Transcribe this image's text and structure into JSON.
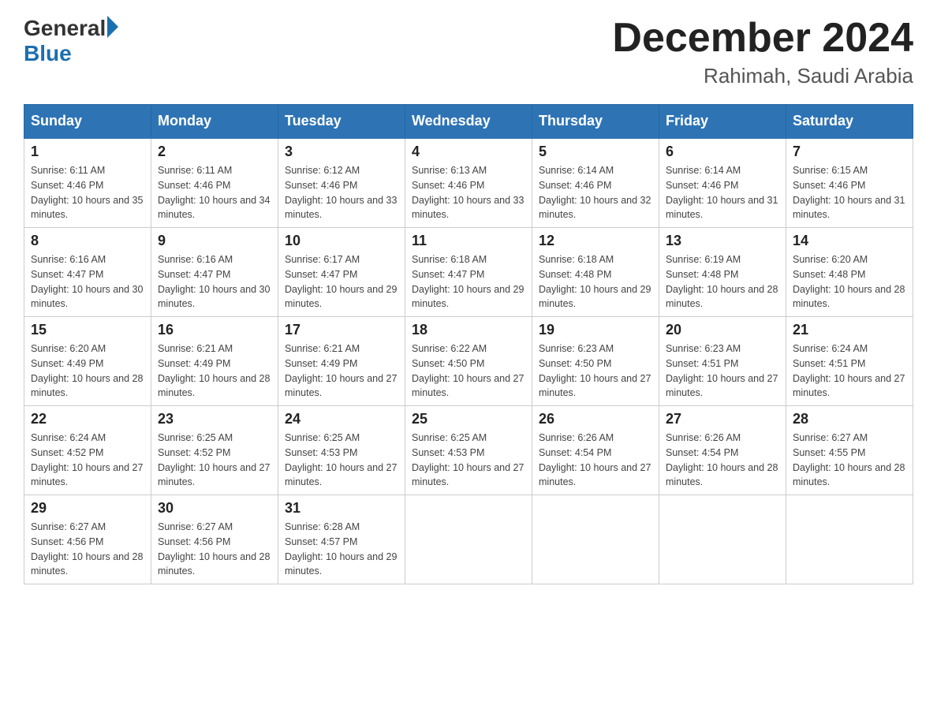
{
  "header": {
    "logo": {
      "general": "General",
      "blue": "Blue",
      "triangle": true
    },
    "title": "December 2024",
    "location": "Rahimah, Saudi Arabia"
  },
  "calendar": {
    "days_of_week": [
      "Sunday",
      "Monday",
      "Tuesday",
      "Wednesday",
      "Thursday",
      "Friday",
      "Saturday"
    ],
    "weeks": [
      [
        {
          "day": "1",
          "sunrise": "6:11 AM",
          "sunset": "4:46 PM",
          "daylight": "10 hours and 35 minutes."
        },
        {
          "day": "2",
          "sunrise": "6:11 AM",
          "sunset": "4:46 PM",
          "daylight": "10 hours and 34 minutes."
        },
        {
          "day": "3",
          "sunrise": "6:12 AM",
          "sunset": "4:46 PM",
          "daylight": "10 hours and 33 minutes."
        },
        {
          "day": "4",
          "sunrise": "6:13 AM",
          "sunset": "4:46 PM",
          "daylight": "10 hours and 33 minutes."
        },
        {
          "day": "5",
          "sunrise": "6:14 AM",
          "sunset": "4:46 PM",
          "daylight": "10 hours and 32 minutes."
        },
        {
          "day": "6",
          "sunrise": "6:14 AM",
          "sunset": "4:46 PM",
          "daylight": "10 hours and 31 minutes."
        },
        {
          "day": "7",
          "sunrise": "6:15 AM",
          "sunset": "4:46 PM",
          "daylight": "10 hours and 31 minutes."
        }
      ],
      [
        {
          "day": "8",
          "sunrise": "6:16 AM",
          "sunset": "4:47 PM",
          "daylight": "10 hours and 30 minutes."
        },
        {
          "day": "9",
          "sunrise": "6:16 AM",
          "sunset": "4:47 PM",
          "daylight": "10 hours and 30 minutes."
        },
        {
          "day": "10",
          "sunrise": "6:17 AM",
          "sunset": "4:47 PM",
          "daylight": "10 hours and 29 minutes."
        },
        {
          "day": "11",
          "sunrise": "6:18 AM",
          "sunset": "4:47 PM",
          "daylight": "10 hours and 29 minutes."
        },
        {
          "day": "12",
          "sunrise": "6:18 AM",
          "sunset": "4:48 PM",
          "daylight": "10 hours and 29 minutes."
        },
        {
          "day": "13",
          "sunrise": "6:19 AM",
          "sunset": "4:48 PM",
          "daylight": "10 hours and 28 minutes."
        },
        {
          "day": "14",
          "sunrise": "6:20 AM",
          "sunset": "4:48 PM",
          "daylight": "10 hours and 28 minutes."
        }
      ],
      [
        {
          "day": "15",
          "sunrise": "6:20 AM",
          "sunset": "4:49 PM",
          "daylight": "10 hours and 28 minutes."
        },
        {
          "day": "16",
          "sunrise": "6:21 AM",
          "sunset": "4:49 PM",
          "daylight": "10 hours and 28 minutes."
        },
        {
          "day": "17",
          "sunrise": "6:21 AM",
          "sunset": "4:49 PM",
          "daylight": "10 hours and 27 minutes."
        },
        {
          "day": "18",
          "sunrise": "6:22 AM",
          "sunset": "4:50 PM",
          "daylight": "10 hours and 27 minutes."
        },
        {
          "day": "19",
          "sunrise": "6:23 AM",
          "sunset": "4:50 PM",
          "daylight": "10 hours and 27 minutes."
        },
        {
          "day": "20",
          "sunrise": "6:23 AM",
          "sunset": "4:51 PM",
          "daylight": "10 hours and 27 minutes."
        },
        {
          "day": "21",
          "sunrise": "6:24 AM",
          "sunset": "4:51 PM",
          "daylight": "10 hours and 27 minutes."
        }
      ],
      [
        {
          "day": "22",
          "sunrise": "6:24 AM",
          "sunset": "4:52 PM",
          "daylight": "10 hours and 27 minutes."
        },
        {
          "day": "23",
          "sunrise": "6:25 AM",
          "sunset": "4:52 PM",
          "daylight": "10 hours and 27 minutes."
        },
        {
          "day": "24",
          "sunrise": "6:25 AM",
          "sunset": "4:53 PM",
          "daylight": "10 hours and 27 minutes."
        },
        {
          "day": "25",
          "sunrise": "6:25 AM",
          "sunset": "4:53 PM",
          "daylight": "10 hours and 27 minutes."
        },
        {
          "day": "26",
          "sunrise": "6:26 AM",
          "sunset": "4:54 PM",
          "daylight": "10 hours and 27 minutes."
        },
        {
          "day": "27",
          "sunrise": "6:26 AM",
          "sunset": "4:54 PM",
          "daylight": "10 hours and 28 minutes."
        },
        {
          "day": "28",
          "sunrise": "6:27 AM",
          "sunset": "4:55 PM",
          "daylight": "10 hours and 28 minutes."
        }
      ],
      [
        {
          "day": "29",
          "sunrise": "6:27 AM",
          "sunset": "4:56 PM",
          "daylight": "10 hours and 28 minutes."
        },
        {
          "day": "30",
          "sunrise": "6:27 AM",
          "sunset": "4:56 PM",
          "daylight": "10 hours and 28 minutes."
        },
        {
          "day": "31",
          "sunrise": "6:28 AM",
          "sunset": "4:57 PM",
          "daylight": "10 hours and 29 minutes."
        },
        null,
        null,
        null,
        null
      ]
    ]
  }
}
